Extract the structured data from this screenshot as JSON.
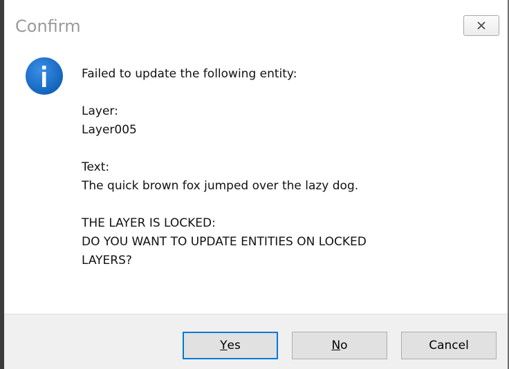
{
  "window": {
    "title": "Confirm",
    "close_symbol": "✕"
  },
  "icon": {
    "name": "info-icon",
    "glyph": "i",
    "color": "#1a6fd0"
  },
  "message": {
    "intro": "Failed to update the following entity:",
    "layer_label": "Layer:",
    "layer_value": "Layer005",
    "text_label": "Text:",
    "text_value": "The quick brown fox jumped over the lazy dog.",
    "warning_line1": "THE LAYER IS LOCKED:",
    "warning_line2": "DO YOU WANT TO UPDATE ENTITIES ON LOCKED",
    "warning_line3": "LAYERS?"
  },
  "buttons": {
    "yes_mnemonic": "Y",
    "yes_rest": "es",
    "no_mnemonic": "N",
    "no_rest": "o",
    "cancel": "Cancel"
  },
  "colors": {
    "accent": "#0078d7",
    "footer_bg": "#f0f0f0",
    "title_text": "#9a9a9a"
  }
}
